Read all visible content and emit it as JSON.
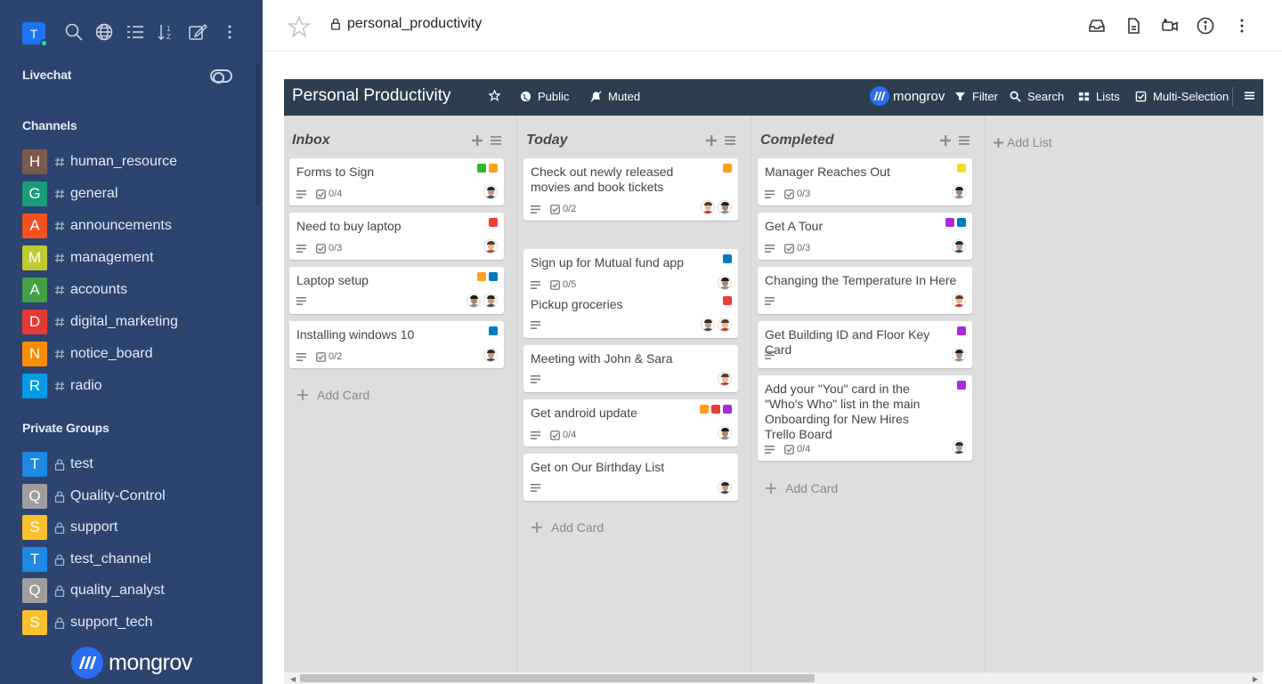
{
  "sidebar": {
    "user_initial": "T",
    "livechat_label": "Livechat",
    "channels_label": "Channels",
    "channels": [
      {
        "initial": "H",
        "name": "human_resource",
        "color": "#7a5a4a"
      },
      {
        "initial": "G",
        "name": "general",
        "color": "#1a9c7a"
      },
      {
        "initial": "A",
        "name": "announcements",
        "color": "#f4511e"
      },
      {
        "initial": "M",
        "name": "management",
        "color": "#c0ca33"
      },
      {
        "initial": "A",
        "name": "accounts",
        "color": "#43a047"
      },
      {
        "initial": "D",
        "name": "digital_marketing",
        "color": "#e53935"
      },
      {
        "initial": "N",
        "name": "notice_board",
        "color": "#fb8c00"
      },
      {
        "initial": "R",
        "name": "radio",
        "color": "#039be5"
      }
    ],
    "private_label": "Private Groups",
    "private_groups": [
      {
        "initial": "T",
        "name": "test",
        "color": "#1e88e5"
      },
      {
        "initial": "Q",
        "name": "Quality-Control",
        "color": "#9e9e9e"
      },
      {
        "initial": "S",
        "name": "support",
        "color": "#fbc02d"
      },
      {
        "initial": "T",
        "name": "test_channel",
        "color": "#1e88e5"
      },
      {
        "initial": "Q",
        "name": "quality_analyst",
        "color": "#9e9e9e"
      },
      {
        "initial": "S",
        "name": "support_tech",
        "color": "#fbc02d"
      }
    ],
    "logo_text": "mongrov"
  },
  "header": {
    "room_name": "personal_productivity"
  },
  "board": {
    "title": "Personal Productivity",
    "public_label": "Public",
    "muted_label": "Muted",
    "logo_text": "mongrov",
    "filter_label": "Filter",
    "search_label": "Search",
    "lists_label": "Lists",
    "multiselect_label": "Multi-Selection",
    "add_card_label": "Add Card",
    "add_list_label": "Add List",
    "lists": [
      {
        "title": "Inbox",
        "cards": [
          {
            "title": "Forms to Sign",
            "labels": [
              "#2eb82e",
              "#ff9f1a"
            ],
            "checklist": "0/4",
            "members": 1
          },
          {
            "title": "Need to buy laptop",
            "labels": [
              "#eb3b3b"
            ],
            "checklist": "0/3",
            "members": 1
          },
          {
            "title": "Laptop setup",
            "labels": [
              "#ff9f1a",
              "#0079bf"
            ],
            "checklist": "",
            "members": 2
          },
          {
            "title": "Installing windows 10",
            "labels": [
              "#0079bf"
            ],
            "checklist": "0/2",
            "members": 1
          }
        ]
      },
      {
        "title": "Today",
        "cards": [
          {
            "title": "Check out newly released movies and book tickets",
            "labels": [
              "#ff9f1a"
            ],
            "checklist": "0/2",
            "members": 2
          },
          {
            "title": "Sign up for Mutual fund app",
            "labels": [
              "#0079bf"
            ],
            "checklist": "0/5",
            "members": 1
          },
          {
            "title": "Pickup groceries",
            "labels": [
              "#eb3b3b"
            ],
            "checklist": "",
            "members": 2
          },
          {
            "title": "Meeting with John & Sara",
            "labels": [],
            "checklist": "",
            "members": 1
          },
          {
            "title": "Get android update",
            "labels": [
              "#ff9f1a",
              "#eb3b3b",
              "#a72ddb"
            ],
            "checklist": "0/4",
            "members": 1
          },
          {
            "title": "Get on Our Birthday List",
            "labels": [],
            "checklist": "",
            "members": 1
          }
        ]
      },
      {
        "title": "Completed",
        "cards": [
          {
            "title": "Manager Reaches Out",
            "labels": [
              "#f5dd29"
            ],
            "checklist": "0/3",
            "members": 1
          },
          {
            "title": "Get A Tour",
            "labels": [
              "#a72ddb",
              "#0079bf"
            ],
            "checklist": "0/3",
            "members": 1
          },
          {
            "title": "Changing the Temperature In Here",
            "labels": [],
            "checklist": "",
            "members": 1
          },
          {
            "title": "Get Building ID and Floor Key Card",
            "labels": [
              "#a72ddb"
            ],
            "checklist": "",
            "members": 1
          },
          {
            "title": "Add your \"You\" card in the \"Who's Who\" list in the main Onboarding for New Hires Trello Board",
            "labels": [
              "#a72ddb"
            ],
            "checklist": "0/4",
            "members": 1
          }
        ]
      }
    ]
  }
}
